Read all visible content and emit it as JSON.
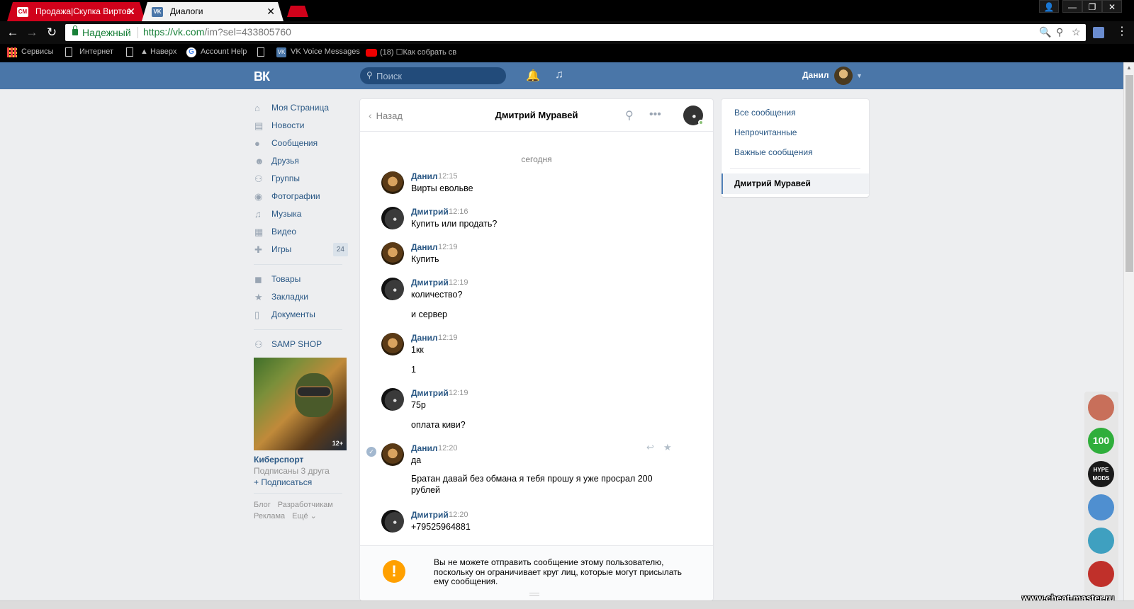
{
  "browser": {
    "tabs": [
      {
        "title": "Продажа|Скупка Виртов.",
        "favicon": "CM"
      },
      {
        "title": "Диалоги",
        "favicon": "VK"
      }
    ],
    "secure_label": "Надежный",
    "url_scheme_host": "https://vk.com",
    "url_rest": "/im?sel=433805760",
    "bookmarks": [
      "Сервисы",
      "Интернет",
      "▲ Наверх",
      "Account Help",
      "",
      "VK Voice Messages",
      "(18) ☐Как собрать св"
    ]
  },
  "vk_header": {
    "logo": "ВК",
    "search_placeholder": "Поиск",
    "user_name": "Данил"
  },
  "left_menu": {
    "items": [
      {
        "label": "Моя Страница",
        "icon": "home-icon"
      },
      {
        "label": "Новости",
        "icon": "news-icon"
      },
      {
        "label": "Сообщения",
        "icon": "messages-icon"
      },
      {
        "label": "Друзья",
        "icon": "friends-icon"
      },
      {
        "label": "Группы",
        "icon": "groups-icon"
      },
      {
        "label": "Фотографии",
        "icon": "photos-icon"
      },
      {
        "label": "Музыка",
        "icon": "music-icon"
      },
      {
        "label": "Видео",
        "icon": "video-icon"
      },
      {
        "label": "Игры",
        "icon": "games-icon",
        "badge": "24"
      }
    ],
    "items2": [
      {
        "label": "Товары",
        "icon": "goods-icon"
      },
      {
        "label": "Закладки",
        "icon": "bookmarks-icon"
      },
      {
        "label": "Документы",
        "icon": "documents-icon"
      }
    ],
    "group": {
      "label": "SAMP SHOP",
      "icon": "group-icon"
    },
    "promo": {
      "age": "12+",
      "title": "Киберспорт",
      "subtitle": "Подписаны 3 друга",
      "follow": "+ Подписаться"
    },
    "footer": [
      "Блог",
      "Разработчикам",
      "Реклама",
      "Ещё ⌄"
    ]
  },
  "chat": {
    "back_label": "Назад",
    "peer_name": "Дмитрий Муравей",
    "day": "сегодня",
    "messages": [
      {
        "author": "Данил",
        "time": "12:15",
        "lines": [
          "Вирты евольве"
        ]
      },
      {
        "author": "Дмитрий",
        "time": "12:16",
        "lines": [
          "Купить или продать?"
        ]
      },
      {
        "author": "Данил",
        "time": "12:19",
        "lines": [
          "Купить"
        ]
      },
      {
        "author": "Дмитрий",
        "time": "12:19",
        "lines": [
          "количество?",
          "и сервер"
        ]
      },
      {
        "author": "Данил",
        "time": "12:19",
        "lines": [
          "1кк",
          "1"
        ]
      },
      {
        "author": "Дмитрий",
        "time": "12:19",
        "lines": [
          "75р",
          "оплата киви?"
        ]
      },
      {
        "author": "Данил",
        "time": "12:20",
        "lines": [
          "да",
          "Братан давай без обмана я тебя прошу я уже просрал 200",
          "рублей"
        ]
      },
      {
        "author": "Дмитрий",
        "time": "12:20",
        "lines": [
          "+79525964881"
        ]
      }
    ],
    "notice": "Вы не можете отправить сообщение этому пользователю, поскольку он ограничивает круг лиц, которые могут присылать ему сообщения."
  },
  "filters": {
    "items": [
      "Все сообщения",
      "Непрочитанные",
      "Важные сообщения"
    ],
    "active": "Дмитрий Муравей"
  },
  "ext_bubbles": [
    "",
    "100",
    "HYPE MODS",
    "",
    "",
    ""
  ],
  "watermark": "www.cheat-master.ru",
  "colors": {
    "vk_blue": "#4a76a8",
    "link": "#2a5885",
    "warning": "#ffa000",
    "secure": "#188038"
  }
}
